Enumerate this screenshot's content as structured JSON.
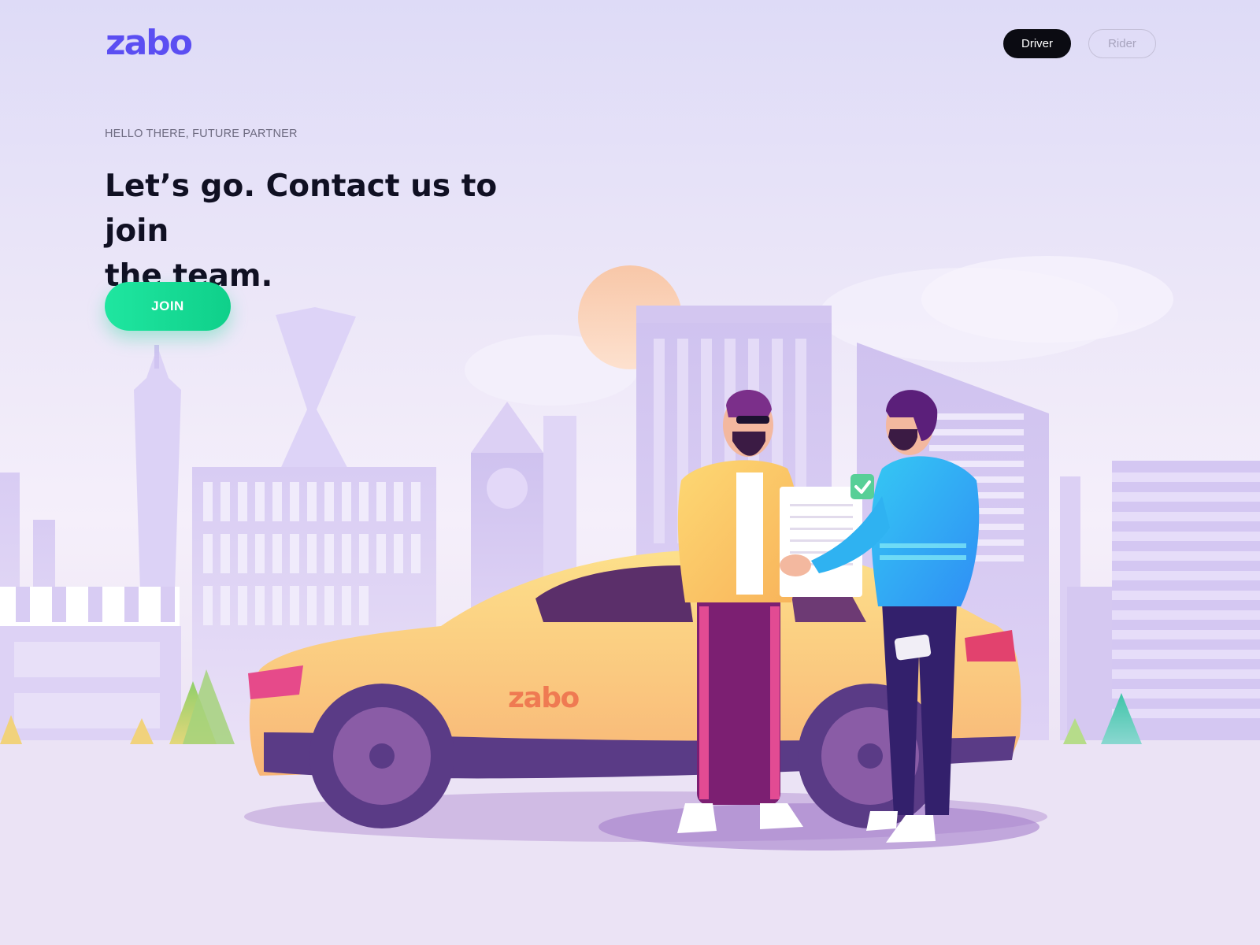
{
  "header": {
    "logo": "zabo",
    "nav": [
      {
        "label": "Driver",
        "active": true
      },
      {
        "label": "Rider",
        "active": false
      }
    ]
  },
  "hero": {
    "eyebrow": "HELLO THERE, FUTURE PARTNER",
    "headline_line1": "Let’s go. Contact us to join",
    "headline_line2": "the team.",
    "cta_label": "JOIN"
  },
  "illustration": {
    "car_logo": "zabo"
  },
  "colors": {
    "brand": "#5b4ef2",
    "cta": "#1fe6a0",
    "car": "#fbd27a"
  }
}
